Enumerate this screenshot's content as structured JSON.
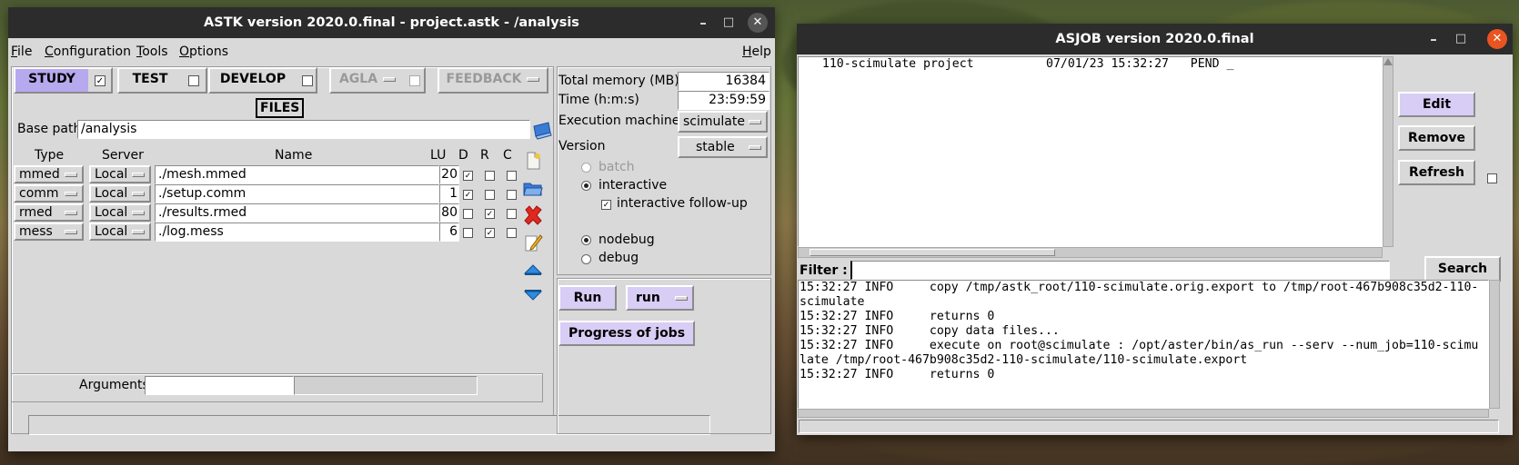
{
  "astk": {
    "title": "ASTK version 2020.0.final - project.astk - /analysis",
    "window_controls": {
      "minimize": "–",
      "maximize": "□",
      "close": "✕"
    },
    "menu": [
      {
        "label": "File",
        "mnemonic": "F",
        "rest": "ile"
      },
      {
        "label": "Configuration",
        "mnemonic": "C",
        "rest": "onfiguration"
      },
      {
        "label": "Tools",
        "mnemonic": "T",
        "rest": "ools"
      },
      {
        "label": "Options",
        "mnemonic": "O",
        "rest": "ptions"
      },
      {
        "label": "Help",
        "mnemonic": "H",
        "rest": "elp"
      }
    ],
    "modes": [
      {
        "label": "STUDY",
        "checked": true,
        "selected": true
      },
      {
        "label": "TEST",
        "checked": false
      },
      {
        "label": "DEVELOP",
        "checked": false
      },
      {
        "label": "AGLA",
        "checked": false,
        "disabled": true
      },
      {
        "label": "FEEDBACK",
        "disabled": true
      }
    ],
    "files_label": "FILES",
    "base_path_label": "Base path",
    "base_path_value": "/analysis",
    "columns": {
      "type": "Type",
      "server": "Server",
      "name": "Name",
      "lu": "LU",
      "d": "D",
      "r": "R",
      "c": "C"
    },
    "rows": [
      {
        "type": "mmed",
        "server": "Local",
        "name": "./mesh.mmed",
        "lu": "20",
        "d": true,
        "r": false,
        "c": false
      },
      {
        "type": "comm",
        "server": "Local",
        "name": "./setup.comm",
        "lu": "1",
        "d": true,
        "r": false,
        "c": false
      },
      {
        "type": "rmed",
        "server": "Local",
        "name": "./results.rmed",
        "lu": "80",
        "d": false,
        "r": true,
        "c": false
      },
      {
        "type": "mess",
        "server": "Local",
        "name": "./log.mess",
        "lu": "6",
        "d": false,
        "r": true,
        "c": false
      }
    ],
    "side_icons": [
      "new-file-icon",
      "open-folder-icon",
      "delete-icon",
      "edit-pencil-icon",
      "move-up-icon",
      "move-down-icon"
    ],
    "arguments_label": "Arguments",
    "arguments_value": "",
    "total_memory_label": "Total memory (MB)",
    "total_memory_value": "16384",
    "time_label": "Time (h:m:s)",
    "time_value": "23:59:59",
    "exec_machine_label": "Execution machine",
    "exec_machine_value": "scimulate",
    "version_label": "Version",
    "version_value": "stable",
    "batch_label": "batch",
    "interactive_label": "interactive",
    "interactive_followup_label": "interactive follow-up",
    "interactive_followup_checked": true,
    "nodebug_label": "nodebug",
    "debug_label": "debug",
    "run_button": "Run",
    "run_mode_value": "run",
    "progress_button": "Progress of jobs"
  },
  "asjob": {
    "title": "ASJOB version 2020.0.final",
    "window_controls": {
      "minimize": "–",
      "maximize": "□",
      "close": "✕"
    },
    "jobs": [
      {
        "line": "  110-scimulate project          07/01/23 15:32:27   PEND _"
      }
    ],
    "edit_button": "Edit",
    "remove_button": "Remove",
    "refresh_button": "Refresh",
    "filter_label": "Filter :",
    "filter_value": "",
    "search_button": "Search",
    "log_lines": [
      "15:32:27 INFO     copy /tmp/astk_root/110-scimulate.orig.export to /tmp/root-467b908c35d2-110-",
      "scimulate",
      "15:32:27 INFO     returns 0",
      "15:32:27 INFO     copy data files...",
      "15:32:27 INFO     execute on root@scimulate : /opt/aster/bin/as_run --serv --num_job=110-scimu",
      "late /tmp/root-467b908c35d2-110-scimulate/110-scimulate.export",
      "15:32:27 INFO     returns 0"
    ]
  },
  "colors": {
    "selected_mode": "#b7a9ee",
    "highlight_button": "#d8cdf5",
    "titlebar": "#2c2c2c",
    "close_red": "#e95420"
  }
}
